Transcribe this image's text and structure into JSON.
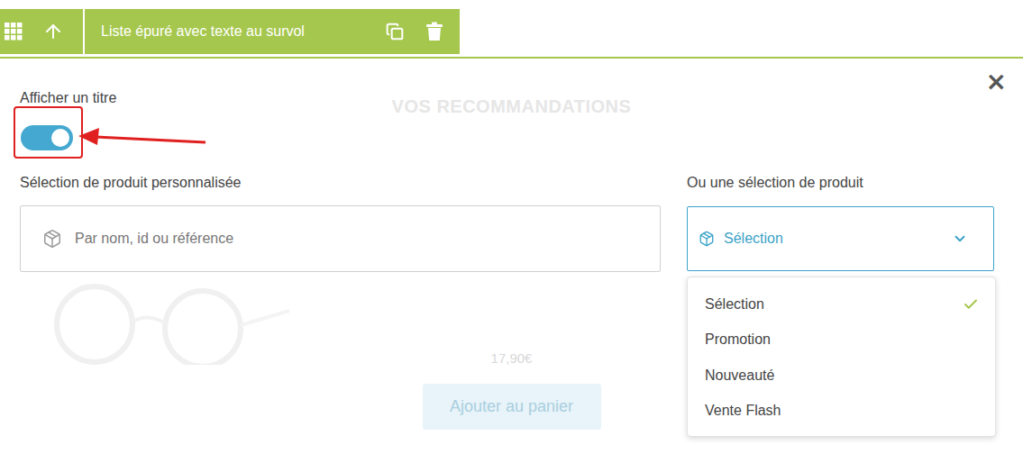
{
  "toolbar": {
    "label": "Liste épuré avec texte au survol"
  },
  "close": "×",
  "preview": {
    "title": "VOS RECOMMANDATIONS",
    "price": "17,90€",
    "button": "Ajouter au panier"
  },
  "title_toggle": {
    "label": "Afficher un titre",
    "on": true,
    "highlighted": true
  },
  "custom_selection": {
    "label": "Sélection de produit personnalisée",
    "placeholder": "Par nom, id ou référence"
  },
  "product_selection": {
    "label": "Ou une sélection de produit",
    "value": "Sélection",
    "expanded": true,
    "options": [
      {
        "label": "Sélection",
        "selected": true
      },
      {
        "label": "Promotion",
        "selected": false
      },
      {
        "label": "Nouveauté",
        "selected": false
      },
      {
        "label": "Vente Flash",
        "selected": false
      }
    ]
  }
}
